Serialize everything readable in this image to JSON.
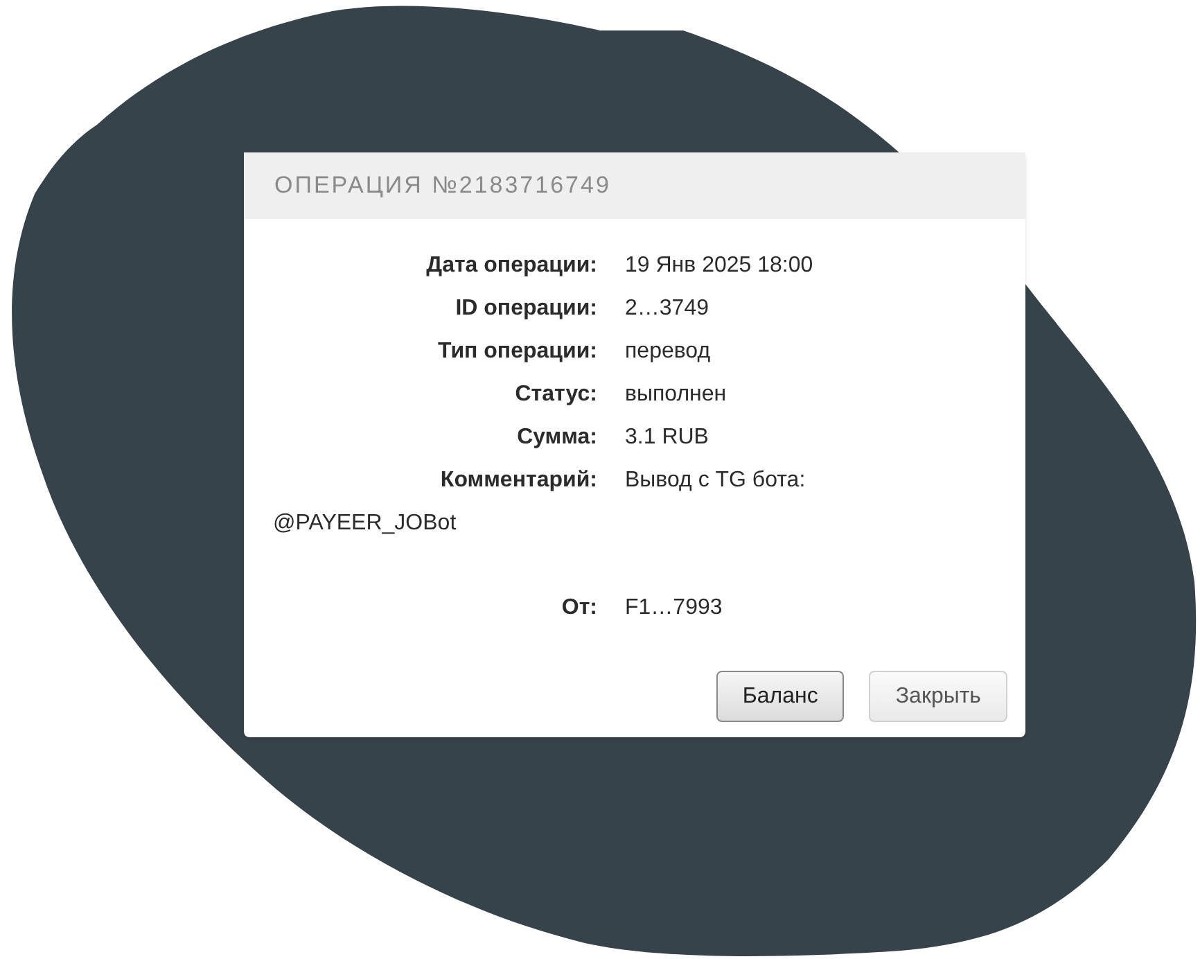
{
  "dialog": {
    "title": "ОПЕРАЦИЯ №2183716749",
    "fields": [
      {
        "label": "Дата операции:",
        "value": "19 Янв 2025 18:00"
      },
      {
        "label": "ID операции:",
        "value": "2…3749"
      },
      {
        "label": "Тип операции:",
        "value": "перевод"
      },
      {
        "label": "Статус:",
        "value": "выполнен"
      },
      {
        "label": "Сумма:",
        "value": "3.1 RUB"
      },
      {
        "label": "Комментарий:",
        "value": "Вывод с TG бота:",
        "continuation": "@PAYEER_JOBot"
      },
      {
        "label": "От:",
        "value": "F1…7993"
      }
    ],
    "buttons": [
      {
        "label": "Баланс",
        "kind": "primary"
      },
      {
        "label": "Закрыть",
        "kind": "secondary"
      }
    ]
  }
}
